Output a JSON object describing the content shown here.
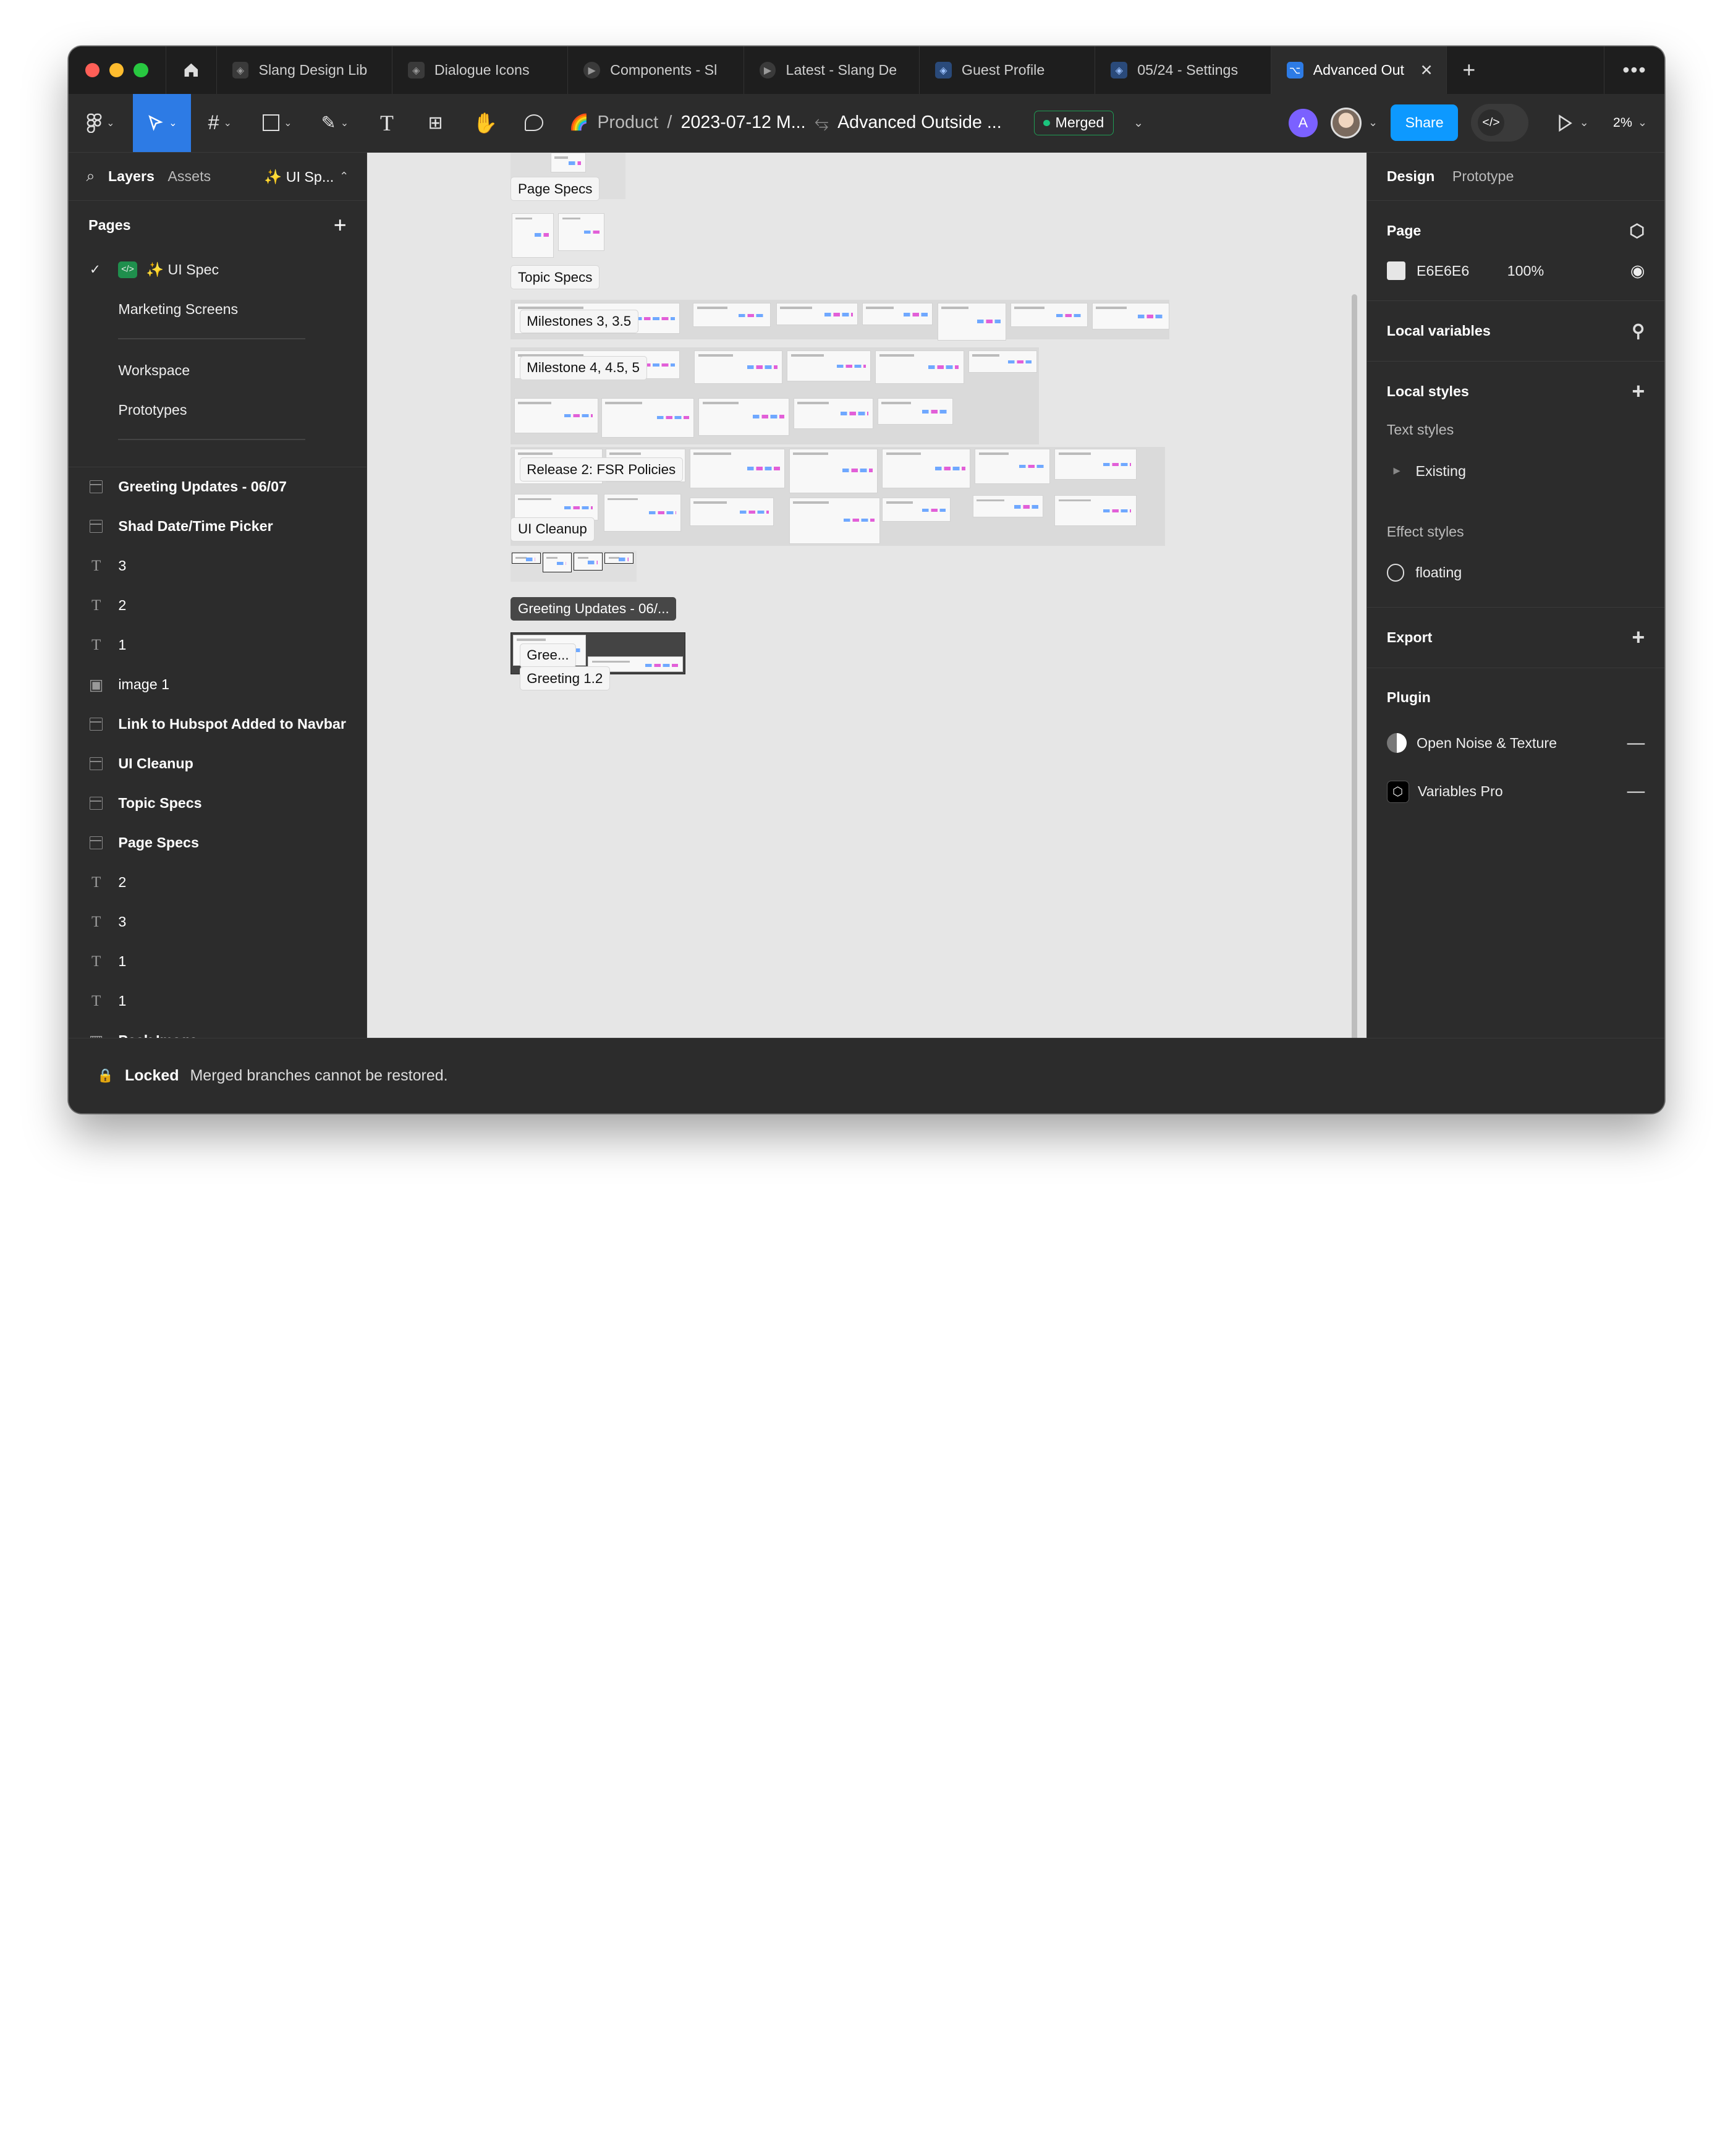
{
  "tabs": {
    "items": [
      {
        "label": "Slang Design Lib"
      },
      {
        "label": "Dialogue Icons"
      },
      {
        "label": "Components - Sl"
      },
      {
        "label": "Latest - Slang De"
      },
      {
        "label": "Guest Profile"
      },
      {
        "label": "05/24 - Settings"
      },
      {
        "label": "Advanced Out"
      }
    ]
  },
  "toolbar": {
    "project": "Product",
    "file": "2023-07-12 M...",
    "branch": "Advanced Outside ...",
    "status_badge": "Merged",
    "avatar_initial": "A",
    "share_label": "Share",
    "zoom": "2%"
  },
  "left_panel": {
    "tab_layers": "Layers",
    "tab_assets": "Assets",
    "page_selector": "✨ UI Sp...",
    "pages_title": "Pages",
    "pages": [
      {
        "label": "✨ UI Spec"
      },
      {
        "label": "Marketing Screens"
      },
      {
        "label": "Workspace"
      },
      {
        "label": "Prototypes"
      }
    ],
    "layers": [
      {
        "label": "Greeting Updates - 06/07",
        "icon": "frame-icon"
      },
      {
        "label": "Shad Date/Time Picker",
        "icon": "frame-icon"
      },
      {
        "label": "3",
        "icon": "text-icon"
      },
      {
        "label": "2",
        "icon": "text-icon"
      },
      {
        "label": "1",
        "icon": "text-icon"
      },
      {
        "label": "image 1",
        "icon": "image-icon"
      },
      {
        "label": "Link to Hubspot Added to Navbar",
        "icon": "frame-icon"
      },
      {
        "label": "UI Cleanup",
        "icon": "frame-icon"
      },
      {
        "label": "Topic Specs",
        "icon": "frame-icon"
      },
      {
        "label": "Page Specs",
        "icon": "frame-icon"
      },
      {
        "label": "2",
        "icon": "text-icon"
      },
      {
        "label": "3",
        "icon": "text-icon"
      },
      {
        "label": "1",
        "icon": "text-icon"
      },
      {
        "label": "1",
        "icon": "text-icon"
      },
      {
        "label": "Peek Image",
        "icon": "chart-icon"
      }
    ]
  },
  "canvas": {
    "labels": {
      "page_specs": "Page Specs",
      "topic_specs": "Topic Specs",
      "milestones_3": "Milestones 3, 3.5",
      "milestone_4": "Milestone 4, 4.5, 5",
      "release_2": "Release 2: FSR Policies",
      "ui_cleanup": "UI Cleanup",
      "greeting_updates": "Greeting Updates - 06/...",
      "gree": "Gree...",
      "greeting_12": "Greeting 1.2"
    }
  },
  "right_panel": {
    "tab_design": "Design",
    "tab_prototype": "Prototype",
    "page_title": "Page",
    "page_color": "E6E6E6",
    "page_opacity": "100%",
    "local_variables": "Local variables",
    "local_styles": "Local styles",
    "text_styles": "Text styles",
    "text_style_group": "Existing",
    "effect_styles": "Effect styles",
    "effect_style": "floating",
    "export": "Export",
    "plugin_title": "Plugin",
    "plugins": [
      {
        "label": "Open Noise & Texture"
      },
      {
        "label": "Variables Pro"
      }
    ]
  },
  "status_bar": {
    "locked": "Locked",
    "message": "Merged branches cannot be restored."
  },
  "colors": {
    "accent": "#0d99ff",
    "selected_tool": "#2d7be5",
    "merged_green": "#1bc47d",
    "canvas_bg": "#E6E6E6"
  }
}
